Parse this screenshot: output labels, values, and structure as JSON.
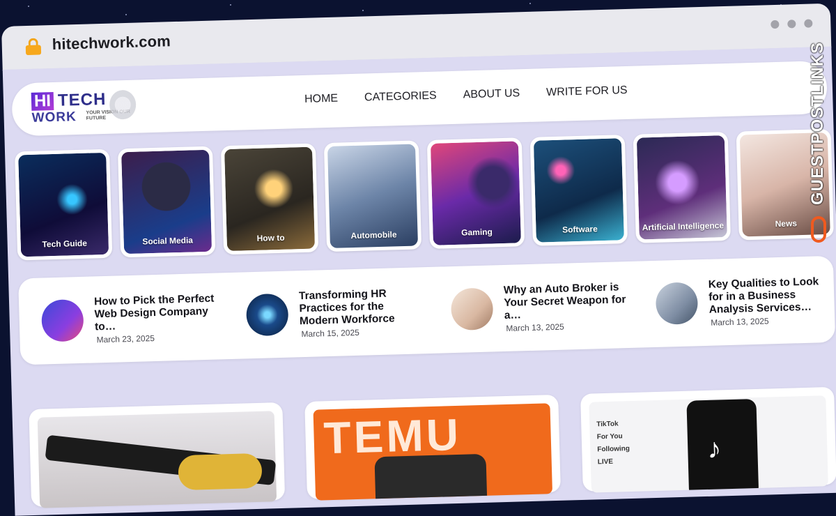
{
  "browser": {
    "url": "hitechwork.com"
  },
  "logo": {
    "hi": "HI",
    "tech": "TECH",
    "work": "WORK",
    "tagline": "YOUR VISION OUR FUTURE"
  },
  "nav": {
    "items": [
      {
        "label": "HOME"
      },
      {
        "label": "CATEGORIES"
      },
      {
        "label": "ABOUT US"
      },
      {
        "label": "WRITE FOR US"
      }
    ]
  },
  "categories": [
    {
      "label": "Tech Guide"
    },
    {
      "label": "Social Media"
    },
    {
      "label": "How to"
    },
    {
      "label": "Automobile"
    },
    {
      "label": "Gaming"
    },
    {
      "label": "Software"
    },
    {
      "label": "Artificial Intelligence"
    },
    {
      "label": "News"
    }
  ],
  "recent_posts": [
    {
      "title": "How to Pick the Perfect Web Design Company to…",
      "date": "March 23, 2025"
    },
    {
      "title": "Transforming HR Practices for the Modern Workforce",
      "date": "March 15, 2025"
    },
    {
      "title": "Why an Auto Broker is Your Secret Weapon for a…",
      "date": "March 13, 2025"
    },
    {
      "title": "Key Qualities to Look for in a Business Analysis Services…",
      "date": "March 13, 2025"
    }
  ],
  "featured": {
    "temu_text": "TEMU",
    "tiktok_sidebar": [
      "TikTok",
      "For You",
      "Following",
      "LIVE"
    ]
  },
  "watermark": {
    "text": "GUESTPOSTLINKS"
  },
  "colors": {
    "page_bg": "#dcdaf2",
    "lock": "#f7a81c",
    "accent": "#f05a1f"
  }
}
